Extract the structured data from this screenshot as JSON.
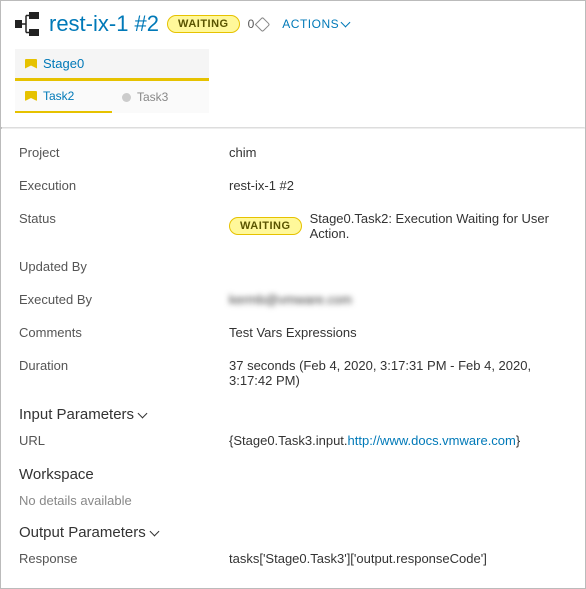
{
  "header": {
    "title": "rest-ix-1 #2",
    "status": "WAITING",
    "tag_count": "0",
    "actions_label": "ACTIONS"
  },
  "stage": {
    "name": "Stage0",
    "tasks": [
      {
        "name": "Task2",
        "state": "waiting"
      },
      {
        "name": "Task3",
        "state": "pending"
      }
    ]
  },
  "details": {
    "project": {
      "label": "Project",
      "value": "chim"
    },
    "execution": {
      "label": "Execution",
      "value": "rest-ix-1 #2"
    },
    "status": {
      "label": "Status",
      "pill": "WAITING",
      "text": "Stage0.Task2: Execution Waiting for User Action."
    },
    "updated_by": {
      "label": "Updated By",
      "value": ""
    },
    "executed_by": {
      "label": "Executed By",
      "value": "kermb@vmware.com"
    },
    "comments": {
      "label": "Comments",
      "value": "Test Vars Expressions"
    },
    "duration": {
      "label": "Duration",
      "value": "37 seconds (Feb 4, 2020, 3:17:31 PM - Feb 4, 2020, 3:17:42 PM)"
    }
  },
  "input_parameters": {
    "heading": "Input Parameters",
    "rows": {
      "url": {
        "label": "URL",
        "prefix": "{Stage0.Task3.input.",
        "link": "http://www.docs.vmware.com",
        "suffix": "}"
      }
    }
  },
  "workspace": {
    "heading": "Workspace",
    "text": "No details available"
  },
  "output_parameters": {
    "heading": "Output Parameters",
    "rows": {
      "response": {
        "label": "Response",
        "value": "tasks['Stage0.Task3']['output.responseCode']"
      }
    }
  }
}
